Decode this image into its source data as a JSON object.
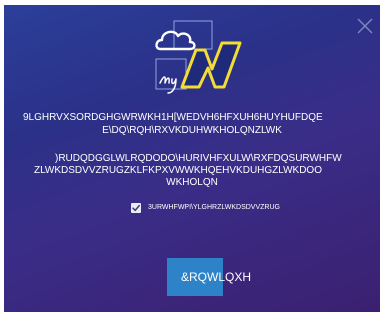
{
  "dialog": {
    "close_icon": "close-icon",
    "logo_icon": "mynortel-logo-icon",
    "intro_line_1": "9LGHRVXSORDGHGWRWKH1H[WEDVH6HFXUH6HUYHUFDQE",
    "intro_line_2": "E\\DQ\\RQH\\RXVKDUHWKHOLQNZLWK",
    "info_line_1": ")RUDQDGGLWLRQDODO\\HURIVHFXULW\\RXFDQSURWHFW",
    "info_line_2": "ZLWKDSDVVZRUGZKLFKPXVWWKHQEHVKDUHGZLWKDOO",
    "info_line_3": "WKHOLQN",
    "password_checkbox_label": "3URWHFWPI\\YLGHRZLWKDSDVVZRUG",
    "password_checkbox_checked": true,
    "continue_label": "&RQWLQXH"
  },
  "colors": {
    "accent": "#2d82c8",
    "background_top": "#2b3f9a",
    "background_bottom": "#3b2070",
    "logo_yellow": "#f3dc33"
  }
}
